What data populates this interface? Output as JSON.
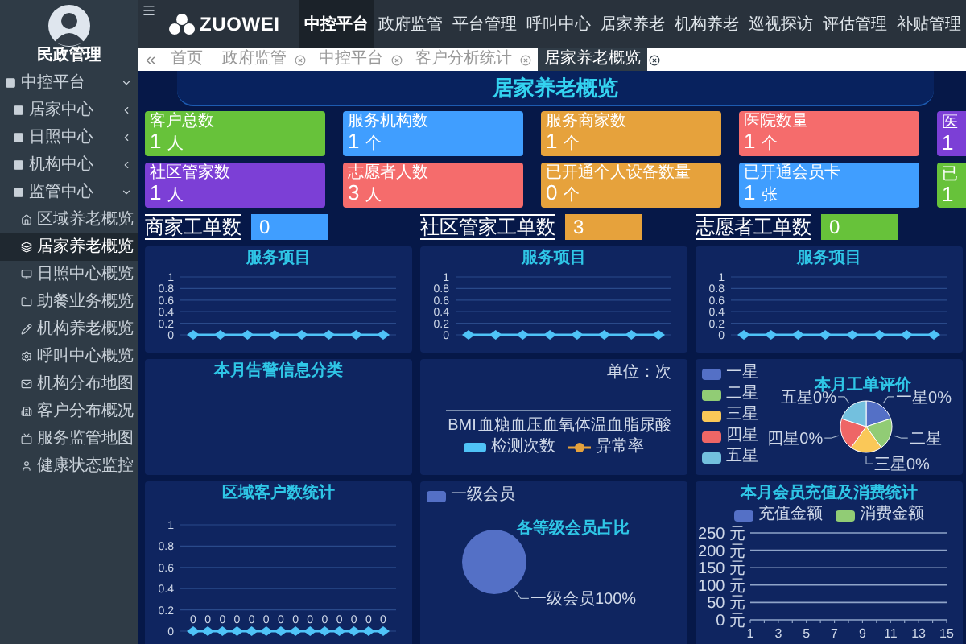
{
  "sidebar": {
    "user": "民政管理",
    "items": [
      {
        "label": "中控平台",
        "expanded": true,
        "children": [
          {
            "label": "居家中心",
            "expanded": false
          },
          {
            "label": "日照中心",
            "expanded": false
          },
          {
            "label": "机构中心",
            "expanded": false
          },
          {
            "label": "监管中心",
            "expanded": true,
            "children": [
              {
                "label": "区域养老概览",
                "selected": false
              },
              {
                "label": "居家养老概览",
                "selected": true
              },
              {
                "label": "日照中心概览",
                "selected": false
              },
              {
                "label": "助餐业务概览",
                "selected": false
              },
              {
                "label": "机构养老概览",
                "selected": false
              },
              {
                "label": "呼叫中心概览",
                "selected": false
              },
              {
                "label": "机构分布地图",
                "selected": false
              },
              {
                "label": "客户分布概况",
                "selected": false
              },
              {
                "label": "服务监管地图",
                "selected": false
              },
              {
                "label": "健康状态监控",
                "selected": false
              }
            ]
          }
        ]
      }
    ]
  },
  "header": {
    "logo": "ZUOWEI",
    "nav": [
      {
        "label": "中控平台",
        "selected": true
      },
      {
        "label": "政府监管",
        "selected": false
      },
      {
        "label": "平台管理",
        "selected": false
      },
      {
        "label": "呼叫中心",
        "selected": false
      },
      {
        "label": "居家养老",
        "selected": false
      },
      {
        "label": "机构养老",
        "selected": false
      },
      {
        "label": "巡视探访",
        "selected": false
      },
      {
        "label": "评估管理",
        "selected": false
      },
      {
        "label": "补贴管理",
        "selected": false
      }
    ]
  },
  "tabs": [
    {
      "label": "首页",
      "closable": false,
      "selected": false
    },
    {
      "label": "政府监管",
      "closable": true,
      "selected": false
    },
    {
      "label": "中控平台",
      "closable": true,
      "selected": false
    },
    {
      "label": "客户分析统计",
      "closable": true,
      "selected": false
    },
    {
      "label": "居家养老概览",
      "closable": true,
      "selected": true
    }
  ],
  "title": "居家养老概览",
  "stats": [
    {
      "label": "客户总数",
      "value": "1",
      "unit": "人",
      "color": "#67c23a"
    },
    {
      "label": "服务机构数",
      "value": "1",
      "unit": "个",
      "color": "#409eff"
    },
    {
      "label": "服务商家数",
      "value": "1",
      "unit": "个",
      "color": "#e6a23c"
    },
    {
      "label": "医院数量",
      "value": "1",
      "unit": "个",
      "color": "#f56c6c"
    },
    {
      "label": "医",
      "value": "1",
      "color": "#7c3fd6"
    },
    {
      "label": "社区管家数",
      "value": "1",
      "unit": "人",
      "color": "#7c3fd6"
    },
    {
      "label": "志愿者人数",
      "value": "3",
      "unit": "人",
      "color": "#f56c6c"
    },
    {
      "label": "已开通个人设备数量",
      "value": "0",
      "unit": "个",
      "color": "#e6a23c"
    },
    {
      "label": "已开通会员卡",
      "value": "1",
      "unit": "张",
      "color": "#409eff"
    },
    {
      "label": "已",
      "value": "1",
      "color": "#67c23a"
    }
  ],
  "work_orders": [
    {
      "label": "商家工单数",
      "value": "0",
      "color": "#409eff"
    },
    {
      "label": "社区管家工单数",
      "value": "3",
      "color": "#e6a23c"
    },
    {
      "label": "志愿者工单数",
      "value": "0",
      "color": "#67c23a"
    }
  ],
  "panels": [
    {
      "title": "服务项目",
      "chart_data": {
        "type": "line",
        "ylim": [
          0,
          1
        ],
        "yticks": [
          0,
          0.2,
          0.4,
          0.6,
          0.8,
          1
        ],
        "grid": true,
        "series": [
          {
            "color": "#4fc3f7",
            "marker": "diamond",
            "values": [
              0,
              0,
              0,
              0,
              0,
              0,
              0,
              0
            ]
          }
        ]
      }
    },
    {
      "title": "服务项目",
      "chart_data": {
        "type": "line",
        "ylim": [
          0,
          1
        ],
        "yticks": [
          0,
          0.2,
          0.4,
          0.6,
          0.8,
          1
        ],
        "grid": true,
        "series": [
          {
            "color": "#4fc3f7",
            "marker": "diamond",
            "values": [
              0,
              0,
              0,
              0,
              0,
              0,
              0,
              0
            ]
          }
        ]
      }
    },
    {
      "title": "服务项目",
      "chart_data": {
        "type": "line",
        "ylim": [
          0,
          1
        ],
        "yticks": [
          0,
          0.2,
          0.4,
          0.6,
          0.8,
          1
        ],
        "grid": true,
        "series": [
          {
            "color": "#4fc3f7",
            "marker": "diamond",
            "values": [
              0,
              0,
              0,
              0,
              0,
              0,
              0,
              0
            ]
          }
        ]
      }
    },
    {
      "kind": "empty",
      "title": "本月告警信息分类"
    },
    {
      "kind": "axis_only",
      "unit": "单位：次",
      "categories": [
        "BMI",
        "血糖",
        "血压",
        "血氧",
        "体温",
        "血脂",
        "尿酸"
      ],
      "legend": [
        {
          "label": "检测次数",
          "kind": "swatch",
          "color": "#4fc3f7"
        },
        {
          "label": "异常率",
          "kind": "line_marker",
          "color": "#e6a23c"
        }
      ]
    },
    {
      "kind": "rating_pie",
      "title": "本月工单评价",
      "legend": [
        {
          "label": "一星",
          "color": "#5470c6"
        },
        {
          "label": "二星",
          "color": "#91cc75"
        },
        {
          "label": "三星",
          "color": "#fac858"
        },
        {
          "label": "四星",
          "color": "#ee6666"
        },
        {
          "label": "五星",
          "color": "#73c0de"
        }
      ],
      "slice_labels": [
        "一星0%",
        "二星",
        "三星0%",
        "四星0%",
        "五星0%"
      ]
    },
    {
      "title": "区域客户数统计",
      "chart_data": {
        "type": "line",
        "ylim": [
          0,
          1
        ],
        "yticks": [
          0,
          0.2,
          0.4,
          0.6,
          0.8,
          1
        ],
        "grid": true,
        "data_labels": true,
        "series": [
          {
            "color": "#4fc3f7",
            "marker": "diamond",
            "values": [
              0,
              0,
              0,
              0,
              0,
              0,
              0,
              0,
              0,
              0,
              0,
              0,
              0,
              0
            ]
          }
        ]
      }
    },
    {
      "chart_data": {
        "type": "pie",
        "title": "各等级会员占比",
        "series": [
          {
            "name": "一级会员",
            "color": "#5470c6",
            "values": [
              100
            ]
          }
        ],
        "value_labels": [
          "一级会员100%"
        ]
      }
    },
    {
      "chart_data": {
        "type": "bar",
        "title": "本月会员充值及消费统计",
        "x": [
          1,
          2,
          3,
          4,
          5,
          6,
          7,
          8,
          9,
          10,
          11,
          12,
          13,
          14,
          15
        ],
        "xlim": [
          1,
          15
        ],
        "xticks": [
          1,
          3,
          5,
          7,
          9,
          11,
          13,
          15
        ],
        "ylim": [
          0,
          250
        ],
        "grid": true,
        "yticks": [
          {
            "value": 0,
            "label": "0 元"
          },
          {
            "value": 50,
            "label": "50 元"
          },
          {
            "value": 100,
            "label": "100 元"
          },
          {
            "value": 150,
            "label": "150 元"
          },
          {
            "value": 200,
            "label": "200 元"
          },
          {
            "value": 250,
            "label": "250 元"
          }
        ],
        "series": [
          {
            "name": "充值金额",
            "color": "#5470c6",
            "values": [
              0,
              0,
              0,
              0,
              0,
              0,
              0,
              0,
              0,
              0,
              0,
              0,
              0,
              0,
              0
            ]
          },
          {
            "name": "消费金额",
            "color": "#91cc75",
            "values": [
              0,
              0,
              0,
              0,
              0,
              0,
              0,
              0,
              0,
              0,
              0,
              0,
              0,
              0,
              0
            ]
          }
        ]
      }
    }
  ]
}
